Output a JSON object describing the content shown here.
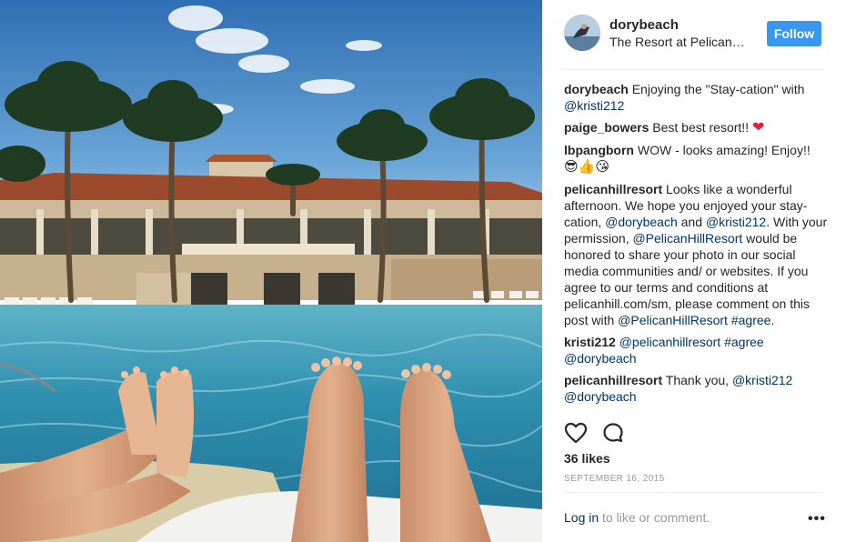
{
  "header": {
    "username": "dorybeach",
    "location": "The Resort at Pelican…",
    "follow_label": "Follow"
  },
  "comments": [
    {
      "user": "dorybeach",
      "parts": [
        {
          "t": "Enjoying the \"Stay-cation\" with "
        },
        {
          "t": "@kristi212",
          "m": true
        }
      ]
    },
    {
      "user": "paige_bowers",
      "parts": [
        {
          "t": "Best best resort!! "
        },
        {
          "t": "❤",
          "h": true
        }
      ]
    },
    {
      "user": "lbpangborn",
      "parts": [
        {
          "t": "WOW - looks amazing! Enjoy!! "
        },
        {
          "t": "😎👍😘",
          "e": true
        }
      ]
    },
    {
      "user": "pelicanhillresort",
      "parts": [
        {
          "t": "Looks like a wonderful afternoon. We hope you enjoyed your stay-cation, "
        },
        {
          "t": "@dorybeach",
          "m": true
        },
        {
          "t": " and "
        },
        {
          "t": "@kristi212",
          "m": true
        },
        {
          "t": ". With your permission, "
        },
        {
          "t": "@PelicanHillResort",
          "m": true
        },
        {
          "t": " would be honored to share your photo in our social media communities and/ or websites. If you agree to our terms and conditions at pelicanhill.com/sm, please comment on this post with "
        },
        {
          "t": "@PelicanHillResort",
          "m": true
        },
        {
          "t": " "
        },
        {
          "t": "#agree",
          "m": true
        },
        {
          "t": "."
        }
      ]
    },
    {
      "user": "kristi212",
      "parts": [
        {
          "t": "@pelicanhillresort",
          "m": true
        },
        {
          "t": " "
        },
        {
          "t": "#agree",
          "m": true
        },
        {
          "t": " "
        },
        {
          "t": "@dorybeach",
          "m": true
        }
      ]
    },
    {
      "user": "pelicanhillresort",
      "parts": [
        {
          "t": "Thank you, "
        },
        {
          "t": "@kristi212",
          "m": true
        },
        {
          "t": " "
        },
        {
          "t": "@dorybeach",
          "m": true
        }
      ]
    }
  ],
  "actions": {
    "like_icon": "heart-outline-icon",
    "comment_icon": "speech-bubble-icon"
  },
  "likes_text": "36 likes",
  "date_text": "SEPTEMBER 16, 2015",
  "footer": {
    "login_link": "Log in",
    "login_rest": " to like or comment.",
    "more_icon": "more-options-icon",
    "more_glyph": "•••"
  },
  "colors": {
    "follow_blue": "#3897f0",
    "mention_blue": "#003569",
    "heart_red": "#e41e3f",
    "muted_gray": "#999999"
  }
}
